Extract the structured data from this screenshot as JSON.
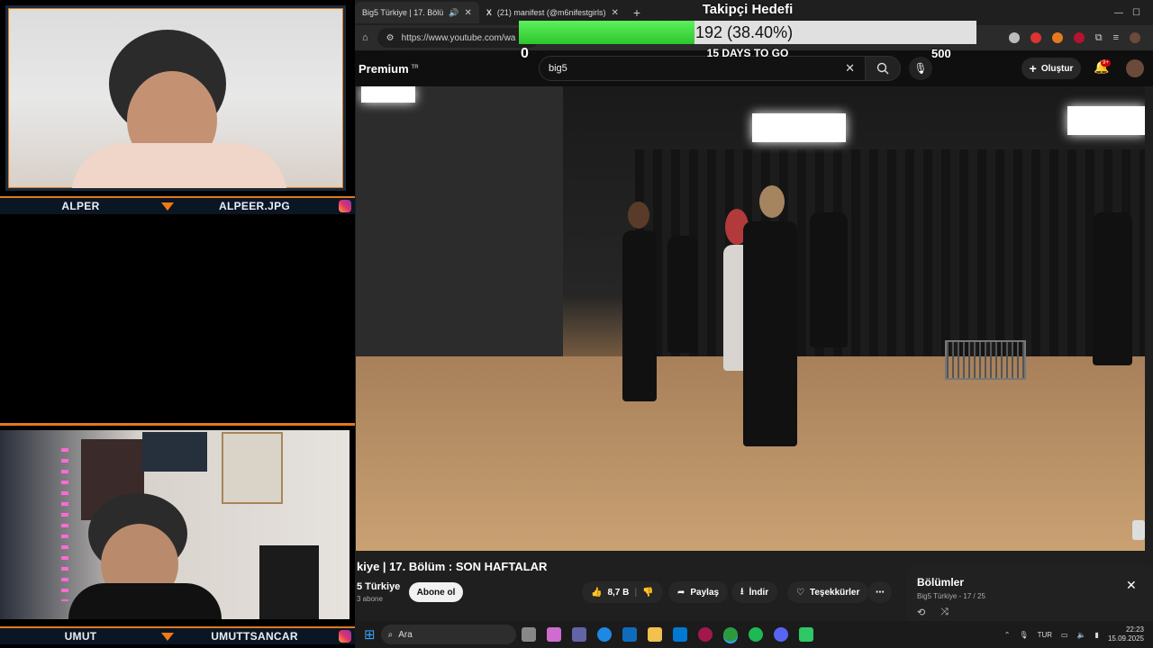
{
  "overlay": {
    "goal": {
      "title": "Takipçi Hedefi",
      "progress_text": "192 (38.40%)",
      "current": 192,
      "fraction": 0.384,
      "min_label": "0",
      "max_label": "500",
      "days_text": "15 DAYS TO GO"
    },
    "cam1": {
      "name": "ALPER",
      "handle": "ALPEER.JPG"
    },
    "cam2": {
      "name": "UMUT",
      "handle": "UMUTTSANCAR"
    }
  },
  "browser": {
    "tabs": [
      {
        "label": "Big5 Türkiye | 17. Bölü"
      },
      {
        "label": "(21) manifest (@m6nifestgirls)"
      }
    ],
    "url": "https://www.youtube.com/wa"
  },
  "youtube": {
    "logo_text": "Premium",
    "logo_sup": "TR",
    "search_value": "big5",
    "create_label": "Oluştur",
    "notif_badge": "9+",
    "video_title": "kiye | 17. Bölüm : SON HAFTALAR",
    "channel_name": "5 Türkiye",
    "channel_subs": "3 abone",
    "subscribe_label": "Abone ol",
    "like_count": "8,7 B",
    "share_label": "Paylaş",
    "download_label": "İndir",
    "thanks_label": "Teşekkürler",
    "chapters": {
      "title": "Bölümler",
      "subtitle": "Big5 Türkiye - 17 / 25"
    }
  },
  "taskbar": {
    "search_placeholder": "Ara",
    "lang": "TUR",
    "time": "22:23",
    "date": "15.09.2025"
  },
  "colors": {
    "accent_orange": "#e07a20",
    "goal_green": "#2ec52e",
    "yt_red": "#cc0000"
  }
}
